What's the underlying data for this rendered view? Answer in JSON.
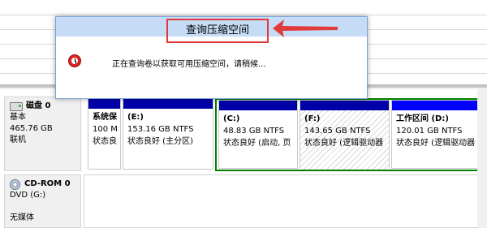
{
  "dialog": {
    "title": "查询压缩空间",
    "message": "正在查询卷以获取可用压缩空间，请稍候..."
  },
  "disks": [
    {
      "name": "磁盘 0",
      "type": "基本",
      "size": "465.76 GB",
      "status": "联机",
      "partitions": [
        {
          "name": "系统保",
          "size": "100 M",
          "status": "状态良"
        },
        {
          "name": "(E:)",
          "size": "153.16 GB NTFS",
          "status": "状态良好 (主分区)"
        },
        {
          "name": "(C:)",
          "size": "48.83 GB NTFS",
          "status": "状态良好 (启动, 页"
        },
        {
          "name": "(F:)",
          "size": "143.65 GB NTFS",
          "status": "状态良好 (逻辑驱动器"
        },
        {
          "name": "工作区间  (D:)",
          "size": "120.01 GB NTFS",
          "status": "状态良好 (逻辑驱动器"
        }
      ]
    },
    {
      "name": "CD-ROM 0",
      "type": "DVD (G:)",
      "status": "无媒体"
    }
  ],
  "colors": {
    "primary_bar": "#0000a8",
    "extended_border": "#008000",
    "highlight": "#e03a3a"
  }
}
